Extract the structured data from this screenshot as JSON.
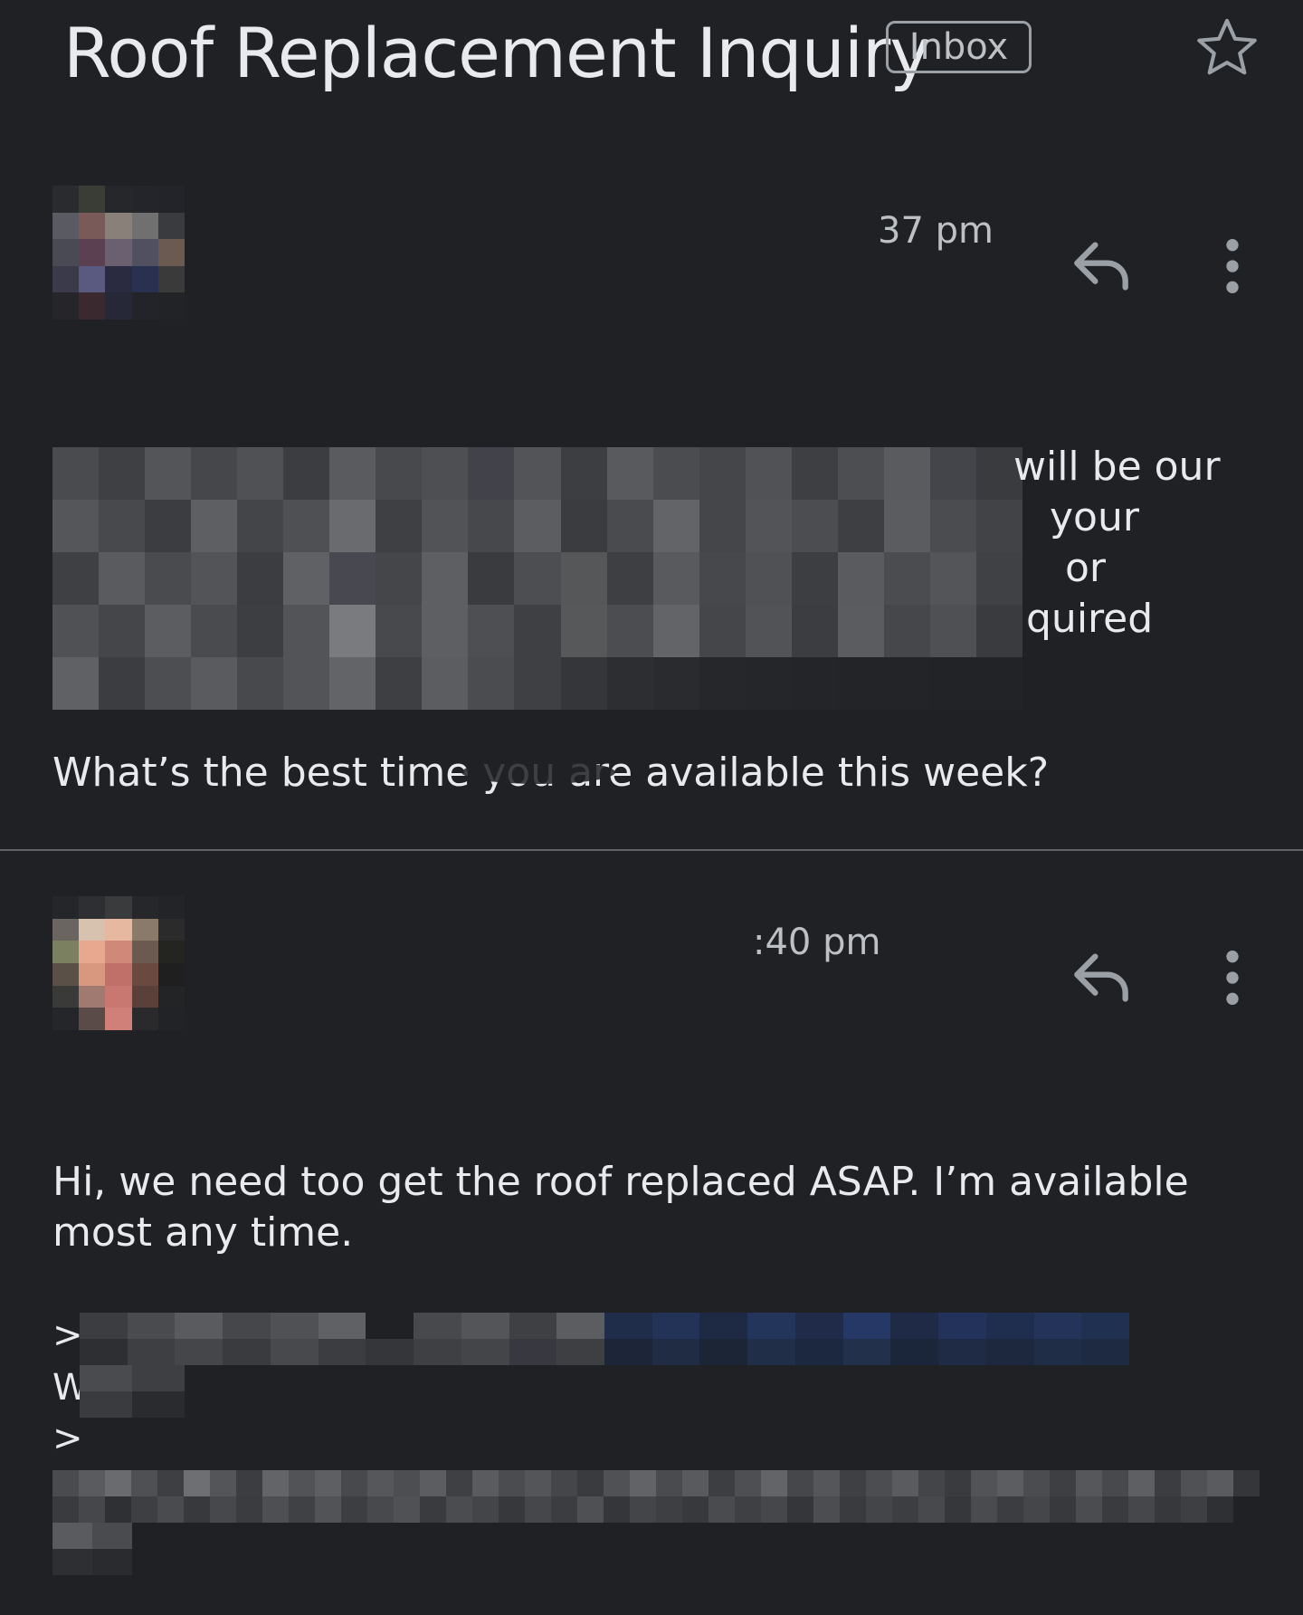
{
  "thread": {
    "subject": "Roof Replacement Inquiry",
    "label": "Inbox",
    "star_icon": "star-outline-icon"
  },
  "messages": [
    {
      "sender_name": "",
      "recipient_line": "",
      "time": "37 pm",
      "reply_icon": "reply-icon",
      "more_icon": "more-vert-icon",
      "body_fragments": [
        "will be our",
        "your",
        "or",
        "quired"
      ],
      "body_last_line": "What’s the best time you are available this week?"
    },
    {
      "sender_name": "",
      "recipient_line": "",
      "time": ":40 pm",
      "reply_icon": "reply-icon",
      "more_icon": "more-vert-icon",
      "body": "Hi, we need too get the roof replaced ASAP. I’m available most any time.",
      "quote_marks": [
        ">",
        "W",
        ">"
      ]
    }
  ],
  "colors": {
    "background": "#202124",
    "text": "#e8eaed",
    "secondary_text": "#bdc1c6",
    "divider": "#5f6368",
    "link_redacted": "#1f2d4a"
  }
}
